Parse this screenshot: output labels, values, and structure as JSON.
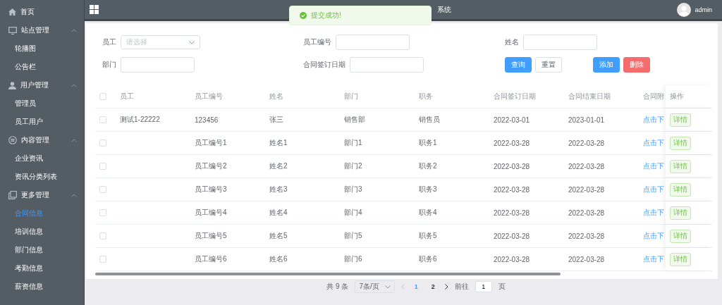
{
  "sidebar": {
    "items": [
      {
        "kind": "item",
        "label": "首页"
      },
      {
        "kind": "group",
        "label": "站点管理",
        "expanded": true,
        "children": [
          {
            "label": "轮播图",
            "selected": false
          },
          {
            "label": "公告栏",
            "selected": false
          }
        ]
      },
      {
        "kind": "group",
        "label": "用户管理",
        "expanded": true,
        "children": [
          {
            "label": "管理员",
            "selected": false
          },
          {
            "label": "员工用户",
            "selected": false
          }
        ]
      },
      {
        "kind": "group",
        "label": "内容管理",
        "expanded": true,
        "children": [
          {
            "label": "企业资讯",
            "selected": false
          },
          {
            "label": "资讯分类列表",
            "selected": false
          }
        ]
      },
      {
        "kind": "group",
        "label": "更多管理",
        "expanded": true,
        "children": [
          {
            "label": "合同信息",
            "selected": true
          },
          {
            "label": "培训信息",
            "selected": false
          },
          {
            "label": "部门信息",
            "selected": false
          },
          {
            "label": "考勤信息",
            "selected": false
          },
          {
            "label": "薪资信息",
            "selected": false
          }
        ]
      }
    ]
  },
  "header": {
    "title": "系统",
    "user": "admin"
  },
  "toast": {
    "kind": "success",
    "message": "提交成功!"
  },
  "filters": [
    {
      "label": "员工",
      "kind": "select",
      "placeholder": "请选择"
    },
    {
      "label": "员工编号",
      "kind": "input"
    },
    {
      "label": "姓名",
      "kind": "input"
    },
    {
      "label": "部门",
      "kind": "input"
    },
    {
      "label": "合同签订日期",
      "kind": "input"
    }
  ],
  "buttons": [
    {
      "label": "查询",
      "kind": "primary"
    },
    {
      "label": "重置",
      "kind": "default"
    },
    {
      "label": "添加",
      "kind": "primary"
    },
    {
      "label": "删除",
      "kind": "danger"
    }
  ],
  "table": {
    "select_all_checked": false,
    "columns": [
      "员工",
      "员工编号",
      "姓名",
      "部门",
      "职务",
      "合同签订日期",
      "合同结束日期",
      "合同附"
    ],
    "action_column": "操作",
    "rows": [
      {
        "checked": false,
        "cells": [
          "测试1-22222",
          "123456",
          "张三",
          "销售部",
          "销售员",
          "2022-03-01",
          "2023-01-01",
          "点击下"
        ],
        "action": "详情"
      },
      {
        "checked": false,
        "cells": [
          "",
          "员工编号1",
          "姓名1",
          "部门1",
          "职务1",
          "2022-03-28",
          "2022-03-28",
          "点击下"
        ],
        "action": "详情"
      },
      {
        "checked": false,
        "cells": [
          "",
          "员工编号2",
          "姓名2",
          "部门2",
          "职务2",
          "2022-03-28",
          "2022-03-28",
          "点击下"
        ],
        "action": "详情"
      },
      {
        "checked": false,
        "cells": [
          "",
          "员工编号3",
          "姓名3",
          "部门3",
          "职务3",
          "2022-03-28",
          "2022-03-28",
          "点击下"
        ],
        "action": "详情"
      },
      {
        "checked": false,
        "cells": [
          "",
          "员工编号4",
          "姓名4",
          "部门4",
          "职务4",
          "2022-03-28",
          "2022-03-28",
          "点击下"
        ],
        "action": "详情"
      },
      {
        "checked": false,
        "cells": [
          "",
          "员工编号5",
          "姓名5",
          "部门5",
          "职务5",
          "2022-03-28",
          "2022-03-28",
          "点击下"
        ],
        "action": "详情"
      },
      {
        "checked": false,
        "cells": [
          "",
          "员工编号6",
          "姓名6",
          "部门6",
          "职务6",
          "2022-03-28",
          "2022-03-28",
          "点击下"
        ],
        "action": "详情"
      }
    ]
  },
  "pagination": {
    "total": "共 9 条",
    "page_size": "7条/页",
    "pages": [
      {
        "label": "1",
        "selected": true
      },
      {
        "label": "2",
        "selected": false
      }
    ],
    "goto_label": "前往",
    "goto_value": "1",
    "goto_suffix": "页"
  }
}
